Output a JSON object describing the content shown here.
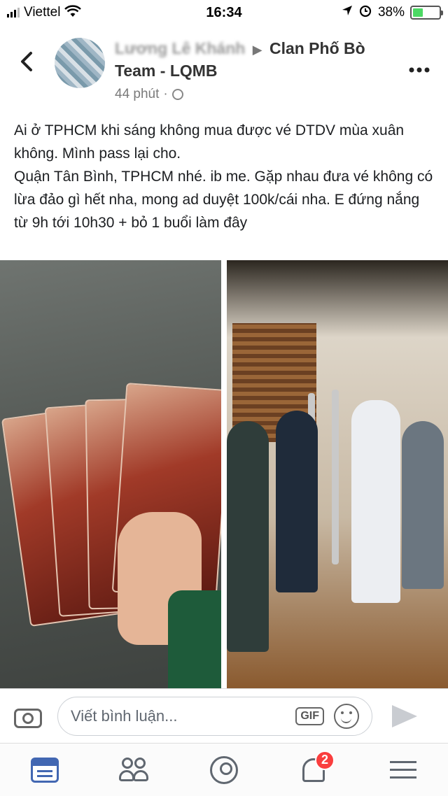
{
  "status_bar": {
    "carrier": "Viettel",
    "time": "16:34",
    "battery_percent": "38%",
    "battery_level": 0.38,
    "icons": [
      "signal-icon",
      "wifi-icon",
      "location-icon",
      "alarm-icon",
      "battery-icon"
    ]
  },
  "header": {
    "author": "Lương Lê Khánh",
    "separator": "▶",
    "group": "Clan Phố Bò Team - LQMB",
    "time_ago": "44 phút",
    "dot": "·",
    "back_icon": "chevron-left-icon",
    "more_icon": "more-icon"
  },
  "post": {
    "text": "Ai ở TPHCM khi sáng không mua được vé DTDV mùa xuân không. Mình pass lại cho.\nQuận Tân Bình, TPHCM nhé. ib me. Gặp nhau đưa vé không có lừa đảo gì hết nha, mong ad duyệt 100k/cái nha. E đứng nắng từ 9h tới 10h30 + bỏ 1 buổi làm đây"
  },
  "comment_bar": {
    "placeholder": "Viết bình luận...",
    "gif_label": "GIF"
  },
  "tab_bar": {
    "notifications_count": "2",
    "accent_color": "#4267b2",
    "badge_color": "#fa3e3e"
  }
}
